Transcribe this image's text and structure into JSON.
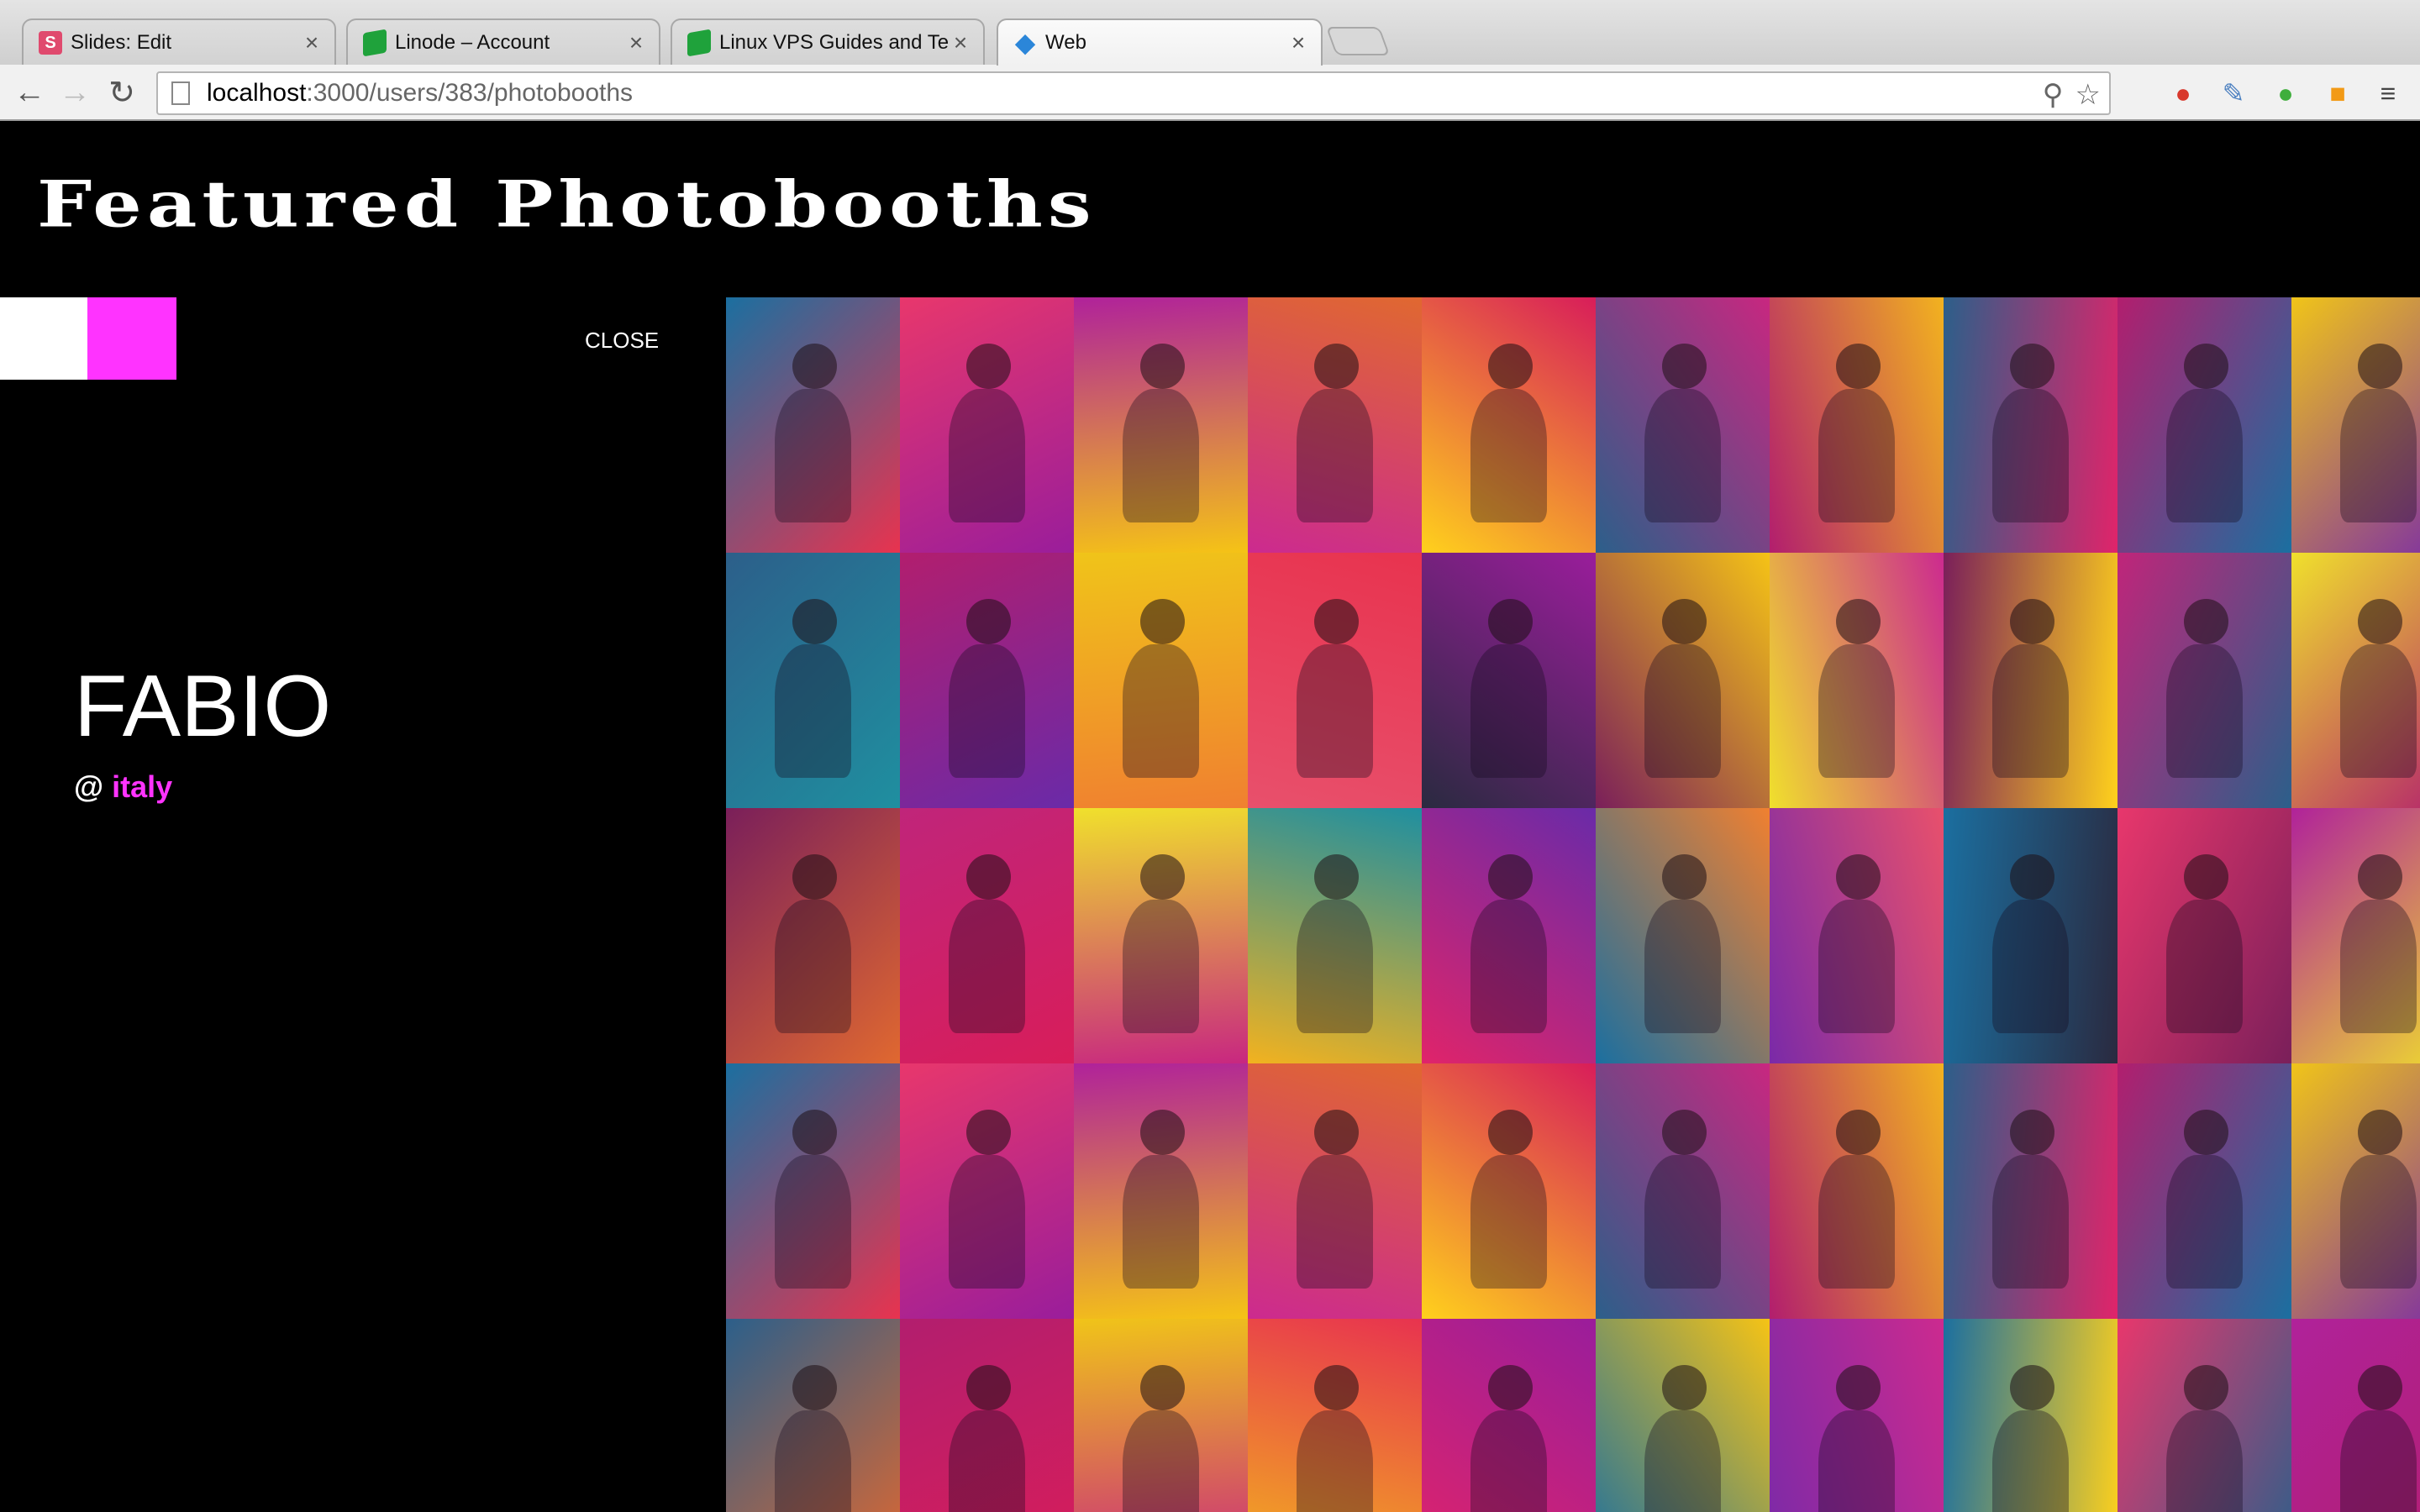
{
  "browser": {
    "tabs": [
      {
        "title": "Slides: Edit",
        "favicon": "slides-s-icon",
        "favicon_glyph": "S",
        "favicon_color": "#e04a6e",
        "active": false
      },
      {
        "title": "Linode – Account",
        "favicon": "linode-cube-icon",
        "favicon_glyph": "",
        "favicon_color": "#1fa23b",
        "active": false
      },
      {
        "title": "Linux VPS Guides and Tech",
        "favicon": "linode-cube-icon",
        "favicon_glyph": "",
        "favicon_color": "#1fa23b",
        "active": false
      },
      {
        "title": "Web",
        "favicon": "web-diamond-icon",
        "favicon_glyph": "",
        "favicon_color": "#2b86d9",
        "active": true
      }
    ],
    "url": {
      "host": "localhost",
      "path": ":3000/users/383/photobooths"
    }
  },
  "page": {
    "title": "Featured Photobooths",
    "swatches": [
      "#ffffff",
      "#ff33ff"
    ],
    "close_label": "CLOSE",
    "user": {
      "name": "FABIO",
      "at": "@",
      "location": "italy"
    },
    "accent_color": "#ff33ff"
  },
  "gallery": {
    "rows": 5,
    "columns": 10,
    "tile_colors": [
      [
        "#1b6fa0",
        "#e8376c",
        "#b0229a",
        "#e06830",
        "#d81d5a",
        "#c82780",
        "#f2b21f",
        "#e0246a",
        "#1b6fa0",
        "#7a2aa8"
      ],
      [
        "#2c5f8a",
        "#b21e6e",
        "#f0c419",
        "#e8334f",
        "#9a1d9b",
        "#f5c316",
        "#cc2a8f",
        "#ffd11c",
        "#2c5f8a",
        "#b21e6e"
      ],
      [
        "#7a1f5a",
        "#c0257a",
        "#f0e02c",
        "#1f8fa0",
        "#6a2aa8",
        "#f08030",
        "#e8506c",
        "#2a2a40",
        "#7a1f5a",
        "#f0e02c"
      ],
      [
        "#1b6fa0",
        "#e8376c",
        "#b0229a",
        "#e06830",
        "#d81d5a",
        "#c82780",
        "#f2b21f",
        "#e0246a",
        "#1b6fa0",
        "#7a2aa8"
      ],
      [
        "#2c5f8a",
        "#b21e6e",
        "#f0c419",
        "#e8334f",
        "#9a1d9b",
        "#f5c316",
        "#cc2a8f",
        "#ffd11c",
        "#2c5f8a",
        "#b21e6e"
      ]
    ]
  }
}
